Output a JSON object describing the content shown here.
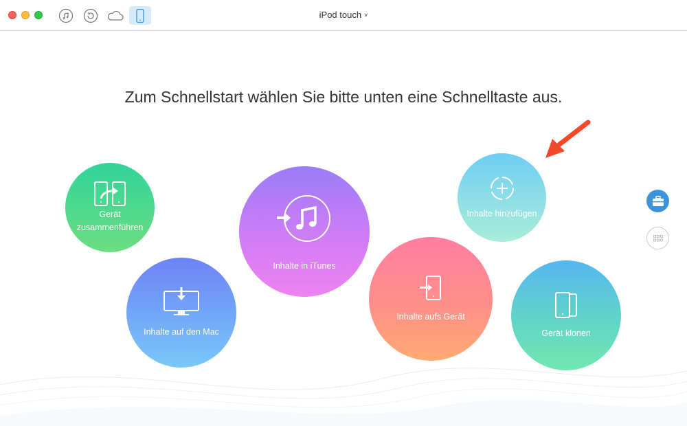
{
  "titlebar": {
    "device_name": "iPod touch",
    "dropdown_chevron": "˅",
    "icons": [
      "music-note-icon",
      "sync-icon",
      "cloud-icon",
      "device-icon"
    ]
  },
  "main": {
    "headline": "Zum Schnellstart wählen Sie bitte unten eine Schnelltaste aus.",
    "actions": [
      {
        "label": "Gerät zusammenführen",
        "icon": "merge-icon",
        "color": "#3ed690"
      },
      {
        "label": "Inhalte auf den Mac",
        "icon": "monitor-download-icon",
        "color": "#7196f7"
      },
      {
        "label": "Inhalte in iTunes",
        "icon": "itunes-import-icon",
        "color": "#c17cf6"
      },
      {
        "label": "Inhalte aufs Gerät",
        "icon": "device-import-icon",
        "color": "#ff8a90"
      },
      {
        "label": "Inhalte hinzufügen",
        "icon": "add-content-icon",
        "color": "#82d9ea"
      },
      {
        "label": "Gerät klonen",
        "icon": "clone-icon",
        "color": "#5ccad6"
      }
    ]
  },
  "sidebar": {
    "buttons": [
      "toolbox-icon",
      "grid-icon"
    ]
  },
  "colors": {
    "accent": "#3c93dc",
    "arrow": "#f4482a"
  }
}
